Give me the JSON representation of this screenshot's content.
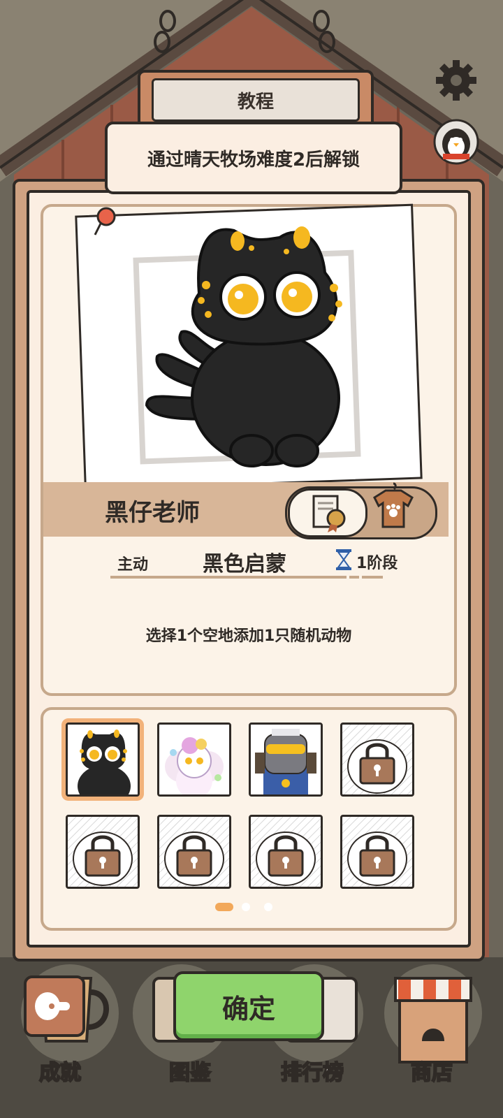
{
  "sign": {
    "title": "教程"
  },
  "banner": {
    "text": "通过晴天牧场难度2后解锁"
  },
  "character": {
    "name": "黑仔老师",
    "skill_type": "主动",
    "skill_name": "黑色启蒙",
    "stage": "1阶段",
    "description": "选择1个空地添加1只随机动物"
  },
  "grid": {
    "slots": [
      {
        "kind": "black-cat",
        "selected": true
      },
      {
        "kind": "fluffy-pastel-cat",
        "selected": false
      },
      {
        "kind": "robot-armor-cat",
        "selected": false
      },
      {
        "kind": "locked",
        "selected": false
      },
      {
        "kind": "locked",
        "selected": false
      },
      {
        "kind": "locked",
        "selected": false
      },
      {
        "kind": "locked",
        "selected": false
      },
      {
        "kind": "locked",
        "selected": false
      }
    ],
    "pages": 3,
    "active_page": 1
  },
  "bottom_nav": {
    "achievements": "成就",
    "catalog": "图鉴",
    "leaderboard": "排行榜",
    "shop": "商店"
  },
  "confirm_label": "确定",
  "colors": {
    "panel": "#cfa282",
    "paper": "#fbeee2",
    "outline": "#2f2a26",
    "confirm": "#8fd46c",
    "selected": "#f2b27a",
    "cat_eye": "#f5b820"
  }
}
